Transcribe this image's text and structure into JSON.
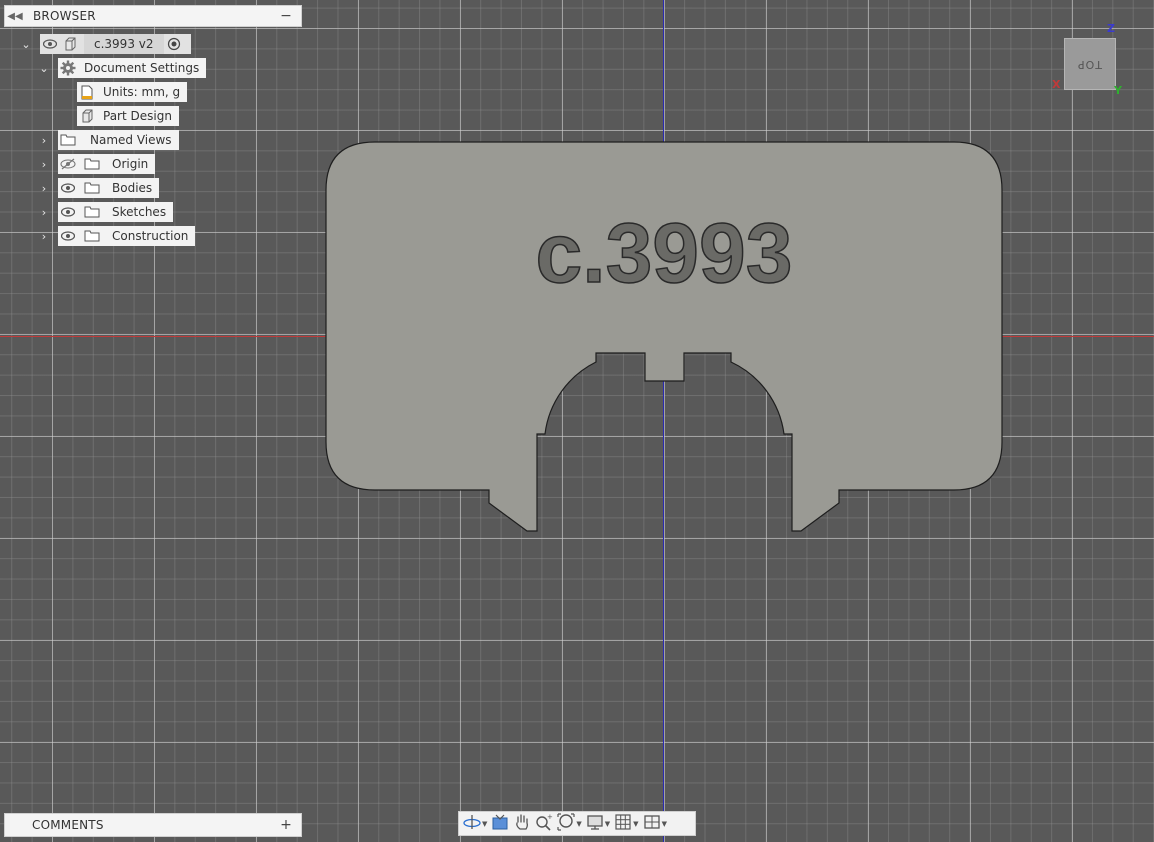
{
  "browser": {
    "title": "BROWSER",
    "collapse_icon": "double-chevron-left-icon",
    "minimize_label": "−",
    "root": {
      "label": "c.3993 v2"
    },
    "items": [
      {
        "label": "Document Settings",
        "icon": "gear-icon"
      },
      {
        "label": "Units: mm, g",
        "icon": "document-icon"
      },
      {
        "label": "Part Design",
        "icon": "component-icon"
      },
      {
        "label": "Named Views",
        "icon": "folder-icon"
      },
      {
        "label": "Origin",
        "icon": "folder-icon",
        "visibility": "hidden"
      },
      {
        "label": "Bodies",
        "icon": "folder-icon",
        "visibility": "visible"
      },
      {
        "label": "Sketches",
        "icon": "folder-icon",
        "visibility": "visible"
      },
      {
        "label": "Construction",
        "icon": "folder-icon",
        "visibility": "visible"
      }
    ]
  },
  "comments": {
    "title": "COMMENTS",
    "add_label": "+"
  },
  "part": {
    "engraved_text": "c.3993"
  },
  "viewcube": {
    "face_label": "TOP",
    "axis_x": "X",
    "axis_y": "Y",
    "axis_z": "Z"
  },
  "toolbar": {
    "tools": [
      "orbit-icon",
      "look-at-icon",
      "pan-icon",
      "zoom-icon",
      "fit-icon",
      "display-settings-icon",
      "grid-icon",
      "viewports-icon"
    ]
  },
  "colors": {
    "background": "#595959",
    "part_fill": "#9a9a94",
    "axis_x": "#c03a3a",
    "axis_y": "#2a2ab0",
    "axis_z": "#3a3ad0",
    "axis_y_label": "#2fb02f"
  }
}
